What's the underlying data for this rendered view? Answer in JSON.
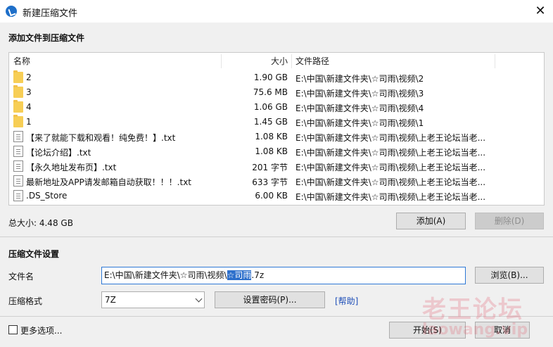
{
  "window": {
    "title": "新建压缩文件",
    "close_glyph": "✕"
  },
  "add_section": {
    "title": "添加文件到压缩文件"
  },
  "file_list": {
    "columns": {
      "name": "名称",
      "size": "大小",
      "path": "文件路径"
    },
    "rows": [
      {
        "type": "folder",
        "name": "2",
        "size": "1.90 GB",
        "path": "E:\\中国\\新建文件夹\\☆司雨\\视频\\2"
      },
      {
        "type": "folder",
        "name": "3",
        "size": "75.6 MB",
        "path": "E:\\中国\\新建文件夹\\☆司雨\\视频\\3"
      },
      {
        "type": "folder",
        "name": "4",
        "size": "1.06 GB",
        "path": "E:\\中国\\新建文件夹\\☆司雨\\视频\\4"
      },
      {
        "type": "folder",
        "name": "1",
        "size": "1.45 GB",
        "path": "E:\\中国\\新建文件夹\\☆司雨\\视频\\1"
      },
      {
        "type": "file",
        "name": "【来了就能下载和观看！纯免费！】.txt",
        "size": "1.08 KB",
        "path": "E:\\中国\\新建文件夹\\☆司雨\\视频\\上老王论坛当老..."
      },
      {
        "type": "file",
        "name": "【论坛介绍】.txt",
        "size": "1.08 KB",
        "path": "E:\\中国\\新建文件夹\\☆司雨\\视频\\上老王论坛当老..."
      },
      {
        "type": "file",
        "name": "【永久地址发布页】.txt",
        "size": "201 字节",
        "path": "E:\\中国\\新建文件夹\\☆司雨\\视频\\上老王论坛当老..."
      },
      {
        "type": "file",
        "name": "最新地址及APP请发邮箱自动获取！！！.txt",
        "size": "633 字节",
        "path": "E:\\中国\\新建文件夹\\☆司雨\\视频\\上老王论坛当老..."
      },
      {
        "type": "file",
        "name": ".DS_Store",
        "size": "6.00 KB",
        "path": "E:\\中国\\新建文件夹\\☆司雨\\视频\\上老王论坛当老..."
      }
    ]
  },
  "total": {
    "text": "总大小: 4.48 GB"
  },
  "buttons": {
    "add": "添加(A)",
    "delete": "删除(D)",
    "browse": "浏览(B)...",
    "set_password": "设置密码(P)...",
    "start": "开始(S)",
    "cancel": "取消"
  },
  "settings": {
    "title": "压缩文件设置",
    "filename_label": "文件名",
    "filename_prefix": "E:\\中国\\新建文件夹\\☆司雨\\视频\\",
    "filename_selected": "☆司雨",
    "filename_suffix": ".7z",
    "format_label": "压缩格式",
    "format_value": "7Z",
    "help_link": "[帮助]"
  },
  "more_options": {
    "label": "更多选项...",
    "checked": false
  },
  "watermark": {
    "line1": "老王论坛",
    "line2": "laowang.vip"
  }
}
